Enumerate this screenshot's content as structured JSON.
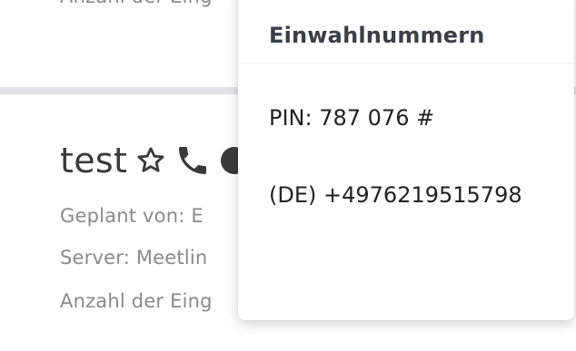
{
  "background": {
    "previous_line_text": "Anzahl der Eing",
    "conference": {
      "title": "test",
      "planned_by": "Geplant von: E",
      "server": "Server: Meetlin",
      "participants": "Anzahl der Eing"
    },
    "icons": [
      "star-outline-icon",
      "phone-icon",
      "circle-icon"
    ]
  },
  "popover": {
    "title": "Einwahlnummern",
    "pin": "PIN: 787 076 #",
    "phone": "(DE) +4976219515798"
  },
  "colors": {
    "title_text": "#3a3a3a",
    "meta_text": "#8a8a8a",
    "divider": "#e1e3e6",
    "popover_text": "#222222",
    "popover_title": "#3a3f45"
  }
}
